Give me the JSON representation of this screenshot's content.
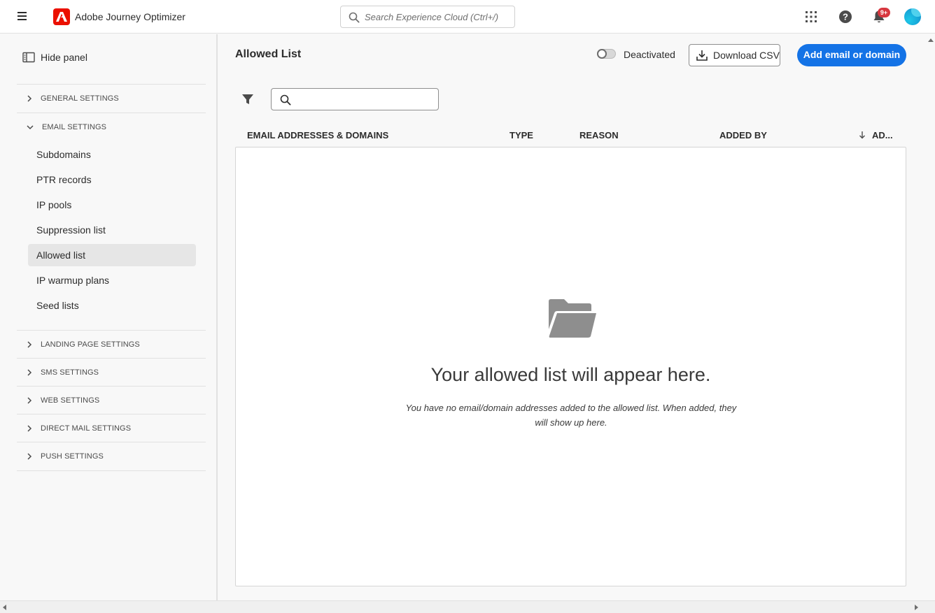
{
  "app": {
    "name": "Adobe Journey Optimizer",
    "brand_color": "#eb1000",
    "accent_color": "#1473e6"
  },
  "topbar": {
    "search_placeholder": "Search Experience Cloud (Ctrl+/)",
    "notifications_badge": "9+",
    "icons": [
      "menu-icon",
      "adobe-logo",
      "search-icon",
      "apps-grid-icon",
      "help-icon",
      "bell-icon",
      "avatar"
    ]
  },
  "sidebar": {
    "hide_panel_label": "Hide panel",
    "sections": [
      {
        "label": "GENERAL SETTINGS",
        "expanded": false
      },
      {
        "label": "EMAIL SETTINGS",
        "expanded": true
      },
      {
        "label": "LANDING PAGE SETTINGS",
        "expanded": false
      },
      {
        "label": "SMS SETTINGS",
        "expanded": false
      },
      {
        "label": "WEB SETTINGS",
        "expanded": false
      },
      {
        "label": "DIRECT MAIL SETTINGS",
        "expanded": false
      },
      {
        "label": "PUSH SETTINGS",
        "expanded": false
      }
    ],
    "email_items": [
      {
        "label": "Subdomains",
        "active": false
      },
      {
        "label": "PTR records",
        "active": false
      },
      {
        "label": "IP pools",
        "active": false
      },
      {
        "label": "Suppression list",
        "active": false
      },
      {
        "label": "Allowed list",
        "active": true
      },
      {
        "label": "IP warmup plans",
        "active": false
      },
      {
        "label": "Seed lists",
        "active": false
      }
    ]
  },
  "main": {
    "title": "Allowed List",
    "toggle_label": "Deactivated",
    "toggle_on": false,
    "download_label": "Download CSV",
    "add_label": "Add email or domain",
    "columns": [
      "EMAIL ADDRESSES & DOMAINS",
      "TYPE",
      "REASON",
      "ADDED BY",
      "AD..."
    ],
    "sorted_column": "AD...",
    "sort_direction": "descending",
    "empty_state": {
      "title": "Your allowed list will appear here.",
      "description": "You have no email/domain addresses added to the allowed list. When added, they will show up here."
    }
  }
}
